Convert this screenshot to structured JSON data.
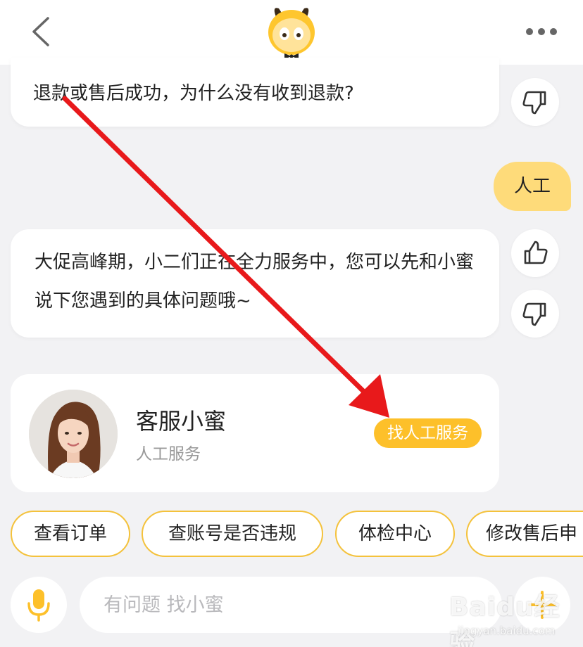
{
  "header": {
    "back_icon": "chevron-left-icon",
    "logo_icon": "mascot-logo-icon",
    "more_icon": "more-dots-icon"
  },
  "messages": [
    {
      "role": "bot",
      "text": "退款或售后成功，为什么没有收到退款?"
    },
    {
      "role": "user",
      "text": "人工"
    },
    {
      "role": "bot",
      "text": "大促高峰期，小二们正在全力服务中，您可以先和小蜜说下您遇到的具体问题哦~"
    }
  ],
  "feedback_icons": [
    "thumbs-down-icon",
    "thumbs-up-icon",
    "thumbs-down-icon"
  ],
  "agent_card": {
    "name": "客服小蜜",
    "role": "人工服务",
    "button_label": "找人工服务"
  },
  "quick_replies": [
    "查看订单",
    "查账号是否违规",
    "体检中心",
    "修改售后申"
  ],
  "input_bar": {
    "placeholder": "有问题 找小蜜",
    "mic_icon": "microphone-icon",
    "plus_icon": "plus-icon"
  },
  "watermark": {
    "main": "Baidu经验",
    "sub": "jingyan.baidu.com"
  },
  "colors": {
    "accent_yellow": "#fdc02a",
    "user_bubble": "#fedb7a",
    "chip_border": "#f4c23c",
    "annotation_arrow": "#e8191b",
    "background": "#f2f2f4"
  }
}
